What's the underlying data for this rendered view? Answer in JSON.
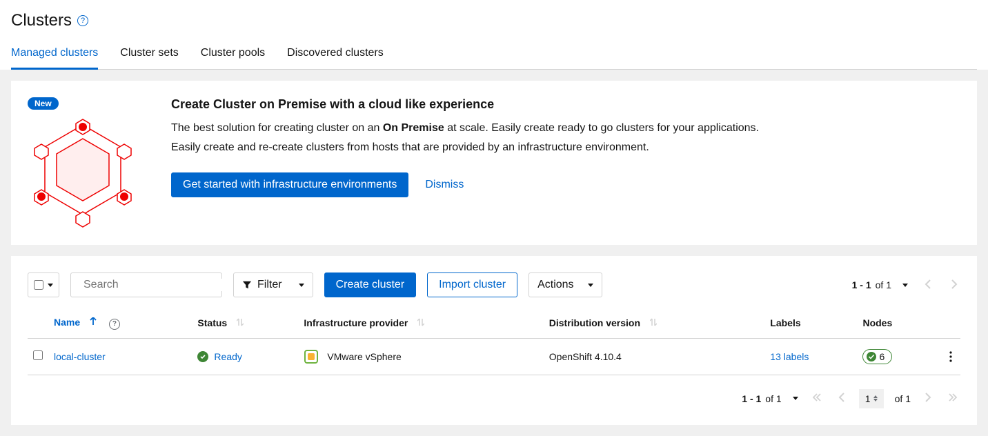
{
  "header": {
    "title": "Clusters"
  },
  "tabs": {
    "managed": "Managed clusters",
    "sets": "Cluster sets",
    "pools": "Cluster pools",
    "discovered": "Discovered clusters"
  },
  "promo": {
    "badge": "New",
    "heading": "Create Cluster on Premise with a cloud like experience",
    "text1_pre": "The best solution for creating cluster on an ",
    "text1_bold": "On Premise",
    "text1_post": " at scale. Easily create ready to go clusters for your applications.",
    "text2": "Easily create and re-create clusters from hosts that are provided by an infrastructure environment.",
    "cta": "Get started with infrastructure environments",
    "dismiss": "Dismiss"
  },
  "toolbar": {
    "search_placeholder": "Search",
    "filter": "Filter",
    "create": "Create cluster",
    "import": "Import cluster",
    "actions": "Actions",
    "range_bold": "1 - 1",
    "range_total": " of 1"
  },
  "table": {
    "columns": {
      "name": "Name",
      "status": "Status",
      "provider": "Infrastructure provider",
      "distribution": "Distribution version",
      "labels": "Labels",
      "nodes": "Nodes"
    },
    "rows": [
      {
        "name": "local-cluster",
        "status": "Ready",
        "provider": "VMware vSphere",
        "distribution": "OpenShift 4.10.4",
        "labels": "13 labels",
        "nodes": "6"
      }
    ]
  },
  "pagination": {
    "range_bold": "1 - 1",
    "range_total": " of 1",
    "page": "1",
    "of_total": "of 1"
  }
}
